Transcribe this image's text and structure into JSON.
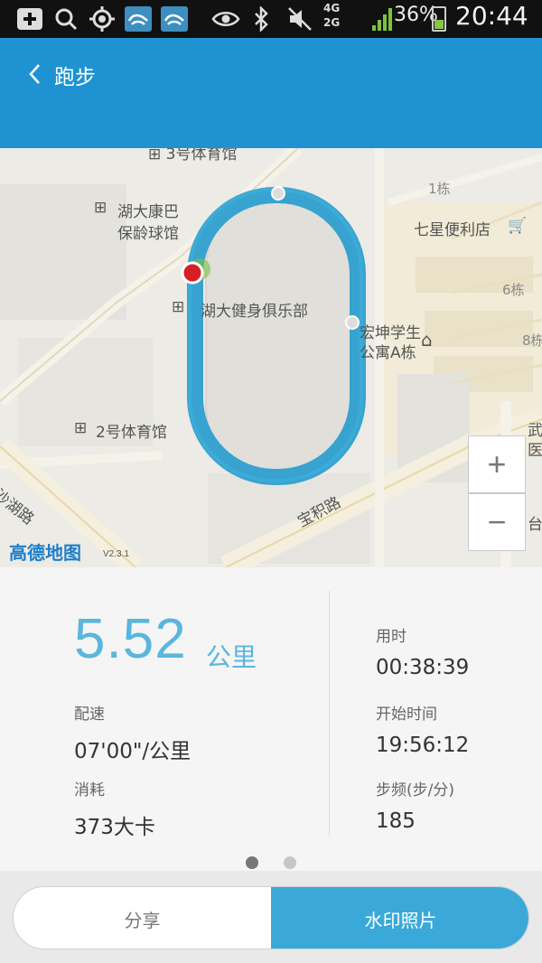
{
  "status_bar": {
    "net_top": "4G",
    "net_bottom": "2G",
    "battery": "36%",
    "time": "20:44",
    "icons": [
      "add-icon",
      "search-icon",
      "location-icon",
      "app-icon",
      "app-icon",
      "eye-icon",
      "bluetooth-icon",
      "mute-icon"
    ]
  },
  "header": {
    "title": "跑步"
  },
  "map": {
    "labels": {
      "gym3": "3号体育馆",
      "hukang1": "湖大康巴",
      "hukang2": "保龄球馆",
      "club": "湖大健身俱乐部",
      "dorm1": "宏坤学生",
      "dorm2": "公寓A栋",
      "gym2": "2号体育馆",
      "store": "七星便利店",
      "bldg1": "1栋",
      "bldg6": "6栋",
      "bldg8": "8栋",
      "wu1": "武",
      "wu2": "医",
      "tai": "台",
      "road1": "沙湖路",
      "road2": "宝积路"
    },
    "zoom_in": "+",
    "zoom_out": "−",
    "logo": "高德地图",
    "version": "V2.3.1",
    "route_color": "#2e9fcf"
  },
  "stats": {
    "distance": "5.52",
    "distance_unit": "公里",
    "pace_label": "配速",
    "pace": "07'00\"/公里",
    "calories_label": "消耗",
    "calories": "373大卡",
    "duration_label": "用时",
    "duration": "00:38:39",
    "start_label": "开始时间",
    "start": "19:56:12",
    "cadence_label": "步频(步/分)",
    "cadence": "185",
    "page_dots": {
      "count": 2,
      "active": 0
    }
  },
  "actions": {
    "share": "分享",
    "watermark": "水印照片"
  }
}
